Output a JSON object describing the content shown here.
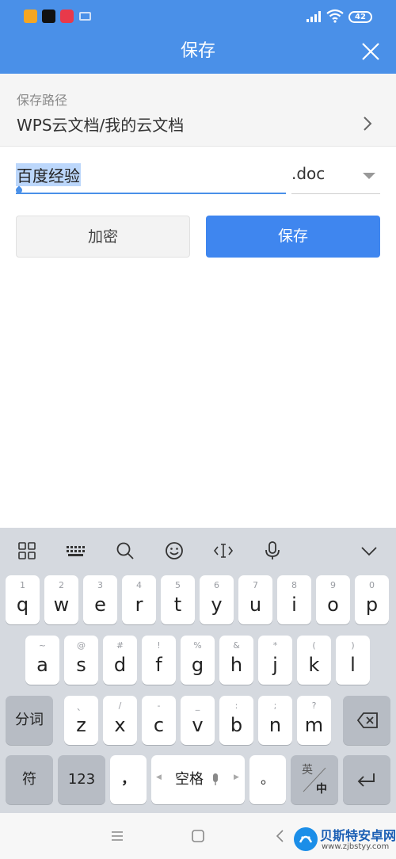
{
  "status_bar": {
    "battery": "42",
    "icons": [
      "app-icon",
      "tiktok-icon",
      "health-icon",
      "keyboard-icon",
      "signal-icon",
      "wifi-icon",
      "battery-icon"
    ]
  },
  "header": {
    "title": "保存",
    "close_icon": "close-icon"
  },
  "path": {
    "label": "保存路径",
    "value": "WPS云文档/我的云文档",
    "chevron_icon": "chevron-right-icon"
  },
  "file": {
    "name": "百度经验",
    "extension": ".doc"
  },
  "buttons": {
    "encrypt": "加密",
    "save": "保存"
  },
  "keyboard": {
    "toolbar": [
      "grid-icon",
      "keypad-icon",
      "search-icon",
      "emoji-icon",
      "text-cursor-icon",
      "mic-icon",
      "chevron-down-icon"
    ],
    "row1": [
      {
        "sub": "1",
        "main": "q"
      },
      {
        "sub": "2",
        "main": "w"
      },
      {
        "sub": "3",
        "main": "e"
      },
      {
        "sub": "4",
        "main": "r"
      },
      {
        "sub": "5",
        "main": "t"
      },
      {
        "sub": "6",
        "main": "y"
      },
      {
        "sub": "7",
        "main": "u"
      },
      {
        "sub": "8",
        "main": "i"
      },
      {
        "sub": "9",
        "main": "o"
      },
      {
        "sub": "0",
        "main": "p"
      }
    ],
    "row2": [
      {
        "sub": "~",
        "main": "a"
      },
      {
        "sub": "@",
        "main": "s"
      },
      {
        "sub": "#",
        "main": "d"
      },
      {
        "sub": "!",
        "main": "f"
      },
      {
        "sub": "%",
        "main": "g"
      },
      {
        "sub": "&",
        "main": "h"
      },
      {
        "sub": "*",
        "main": "j"
      },
      {
        "sub": "(",
        "main": "k"
      },
      {
        "sub": ")",
        "main": "l"
      }
    ],
    "row3": [
      {
        "sub": "、",
        "main": "z"
      },
      {
        "sub": "/",
        "main": "x"
      },
      {
        "sub": "-",
        "main": "c"
      },
      {
        "sub": "_",
        "main": "v"
      },
      {
        "sub": ":",
        "main": "b"
      },
      {
        "sub": ";",
        "main": "n"
      },
      {
        "sub": "?",
        "main": "m"
      }
    ],
    "segment": "分词",
    "symbols": "符",
    "numbers": "123",
    "comma": "，",
    "space": "空格",
    "period": "。",
    "lang_en": "英",
    "lang_zh": "中"
  },
  "navbar": {
    "icons": [
      "menu-icon",
      "home-icon",
      "back-icon"
    ]
  },
  "watermark": {
    "name": "贝斯特安卓网",
    "url": "www.zjbstyy.com"
  }
}
